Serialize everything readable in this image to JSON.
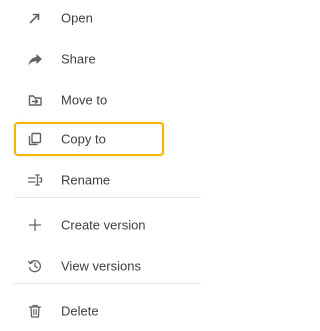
{
  "menu": {
    "items": [
      {
        "label": "Open",
        "icon": "arrow-up-right-icon"
      },
      {
        "label": "Share",
        "icon": "share-icon"
      },
      {
        "label": "Move to",
        "icon": "move-to-icon"
      },
      {
        "label": "Copy to",
        "icon": "copy-icon",
        "highlighted": true
      },
      {
        "label": "Rename",
        "icon": "rename-icon"
      },
      {
        "label": "Create version",
        "icon": "plus-icon"
      },
      {
        "label": "View versions",
        "icon": "history-icon"
      },
      {
        "label": "Delete",
        "icon": "trash-icon"
      }
    ]
  },
  "colors": {
    "text": "#3c4043",
    "icon": "#5f6368",
    "highlight_border": "#f4b400",
    "divider": "#e6e6e6",
    "background": "#ffffff"
  }
}
